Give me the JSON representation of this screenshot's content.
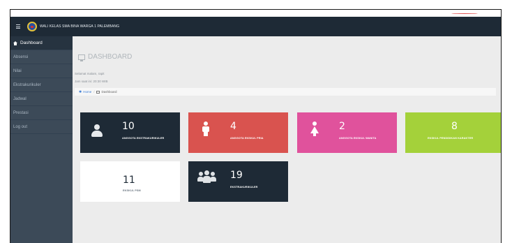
{
  "brand": {
    "title": "WALI KELAS SMA BINA WARGA 1 PALEMBANG"
  },
  "sidebar": {
    "items": [
      {
        "label": "Dashboard"
      },
      {
        "label": "Absensi"
      },
      {
        "label": "Nilai"
      },
      {
        "label": "Ekstrakurikuler"
      },
      {
        "label": "Jadwal"
      },
      {
        "label": "Prestasi"
      },
      {
        "label": "Log out"
      }
    ]
  },
  "header": {
    "title": "DASHBOARD",
    "greeting": "Selamat malam, rapit",
    "clock": "Jam saat ini: 20:30 WIB"
  },
  "breadcrumb": {
    "home": "Home",
    "current": "Dashboard"
  },
  "cards": [
    {
      "value": "10",
      "label": "ANGGOTA EKSTRAKURIKULER",
      "color": "#1e2a36",
      "icon": "user-icon"
    },
    {
      "value": "4",
      "label": "ANGGOTA EKSKUL PRIA",
      "color": "#d9534f",
      "icon": "male-icon"
    },
    {
      "value": "2",
      "label": "ANGGOTA EKSKUL WANITA",
      "color": "#e0529c",
      "icon": "female-icon"
    },
    {
      "value": "8",
      "label": "EKSKUL PENDIDIKAN KARAKTER",
      "color": "#a4d13a",
      "icon": "none"
    },
    {
      "value": "11",
      "label": "EKSKUL PSM",
      "color": "#ffffff",
      "icon": "none"
    },
    {
      "value": "19",
      "label": "EKSTRAKURIKULER",
      "color": "#1e2a36",
      "icon": "users-icon"
    }
  ]
}
